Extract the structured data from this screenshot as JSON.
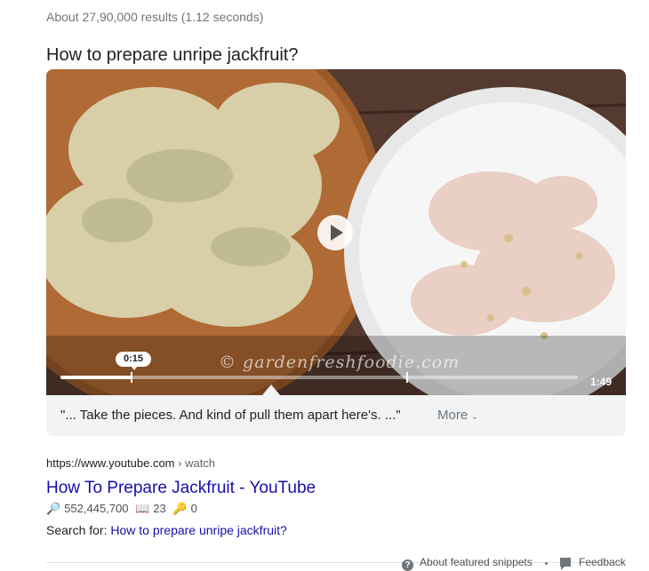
{
  "results_stats": "About 27,90,000 results (1.12 seconds)",
  "snippet": {
    "question": "How to prepare unripe jackfruit?",
    "video": {
      "watermark": "© gardenfreshfoodie.com",
      "current_time": "0:15",
      "duration": "1:49",
      "progress": 0.137,
      "clip_end": 0.67,
      "play_icon": "play-icon"
    },
    "caption": "\"... Take the pieces. And kind of pull them apart here's. ...\"",
    "more_label": "More",
    "more_icon": "chevron-down-icon"
  },
  "result": {
    "url": "https://www.youtube.com",
    "breadcrumb": "› watch",
    "title": "How To Prepare Jackfruit - YouTube",
    "views": "552,445,700",
    "book_count": "23",
    "key_count": "0",
    "search_for_label": "Search for:",
    "search_for_link": "How to prepare unripe jackfruit?"
  },
  "footer": {
    "about_label": "About featured snippets",
    "feedback_label": "Feedback"
  },
  "colors": {
    "link": "#1a0dab",
    "muted": "#70757a",
    "panel": "#f1f3f4"
  }
}
